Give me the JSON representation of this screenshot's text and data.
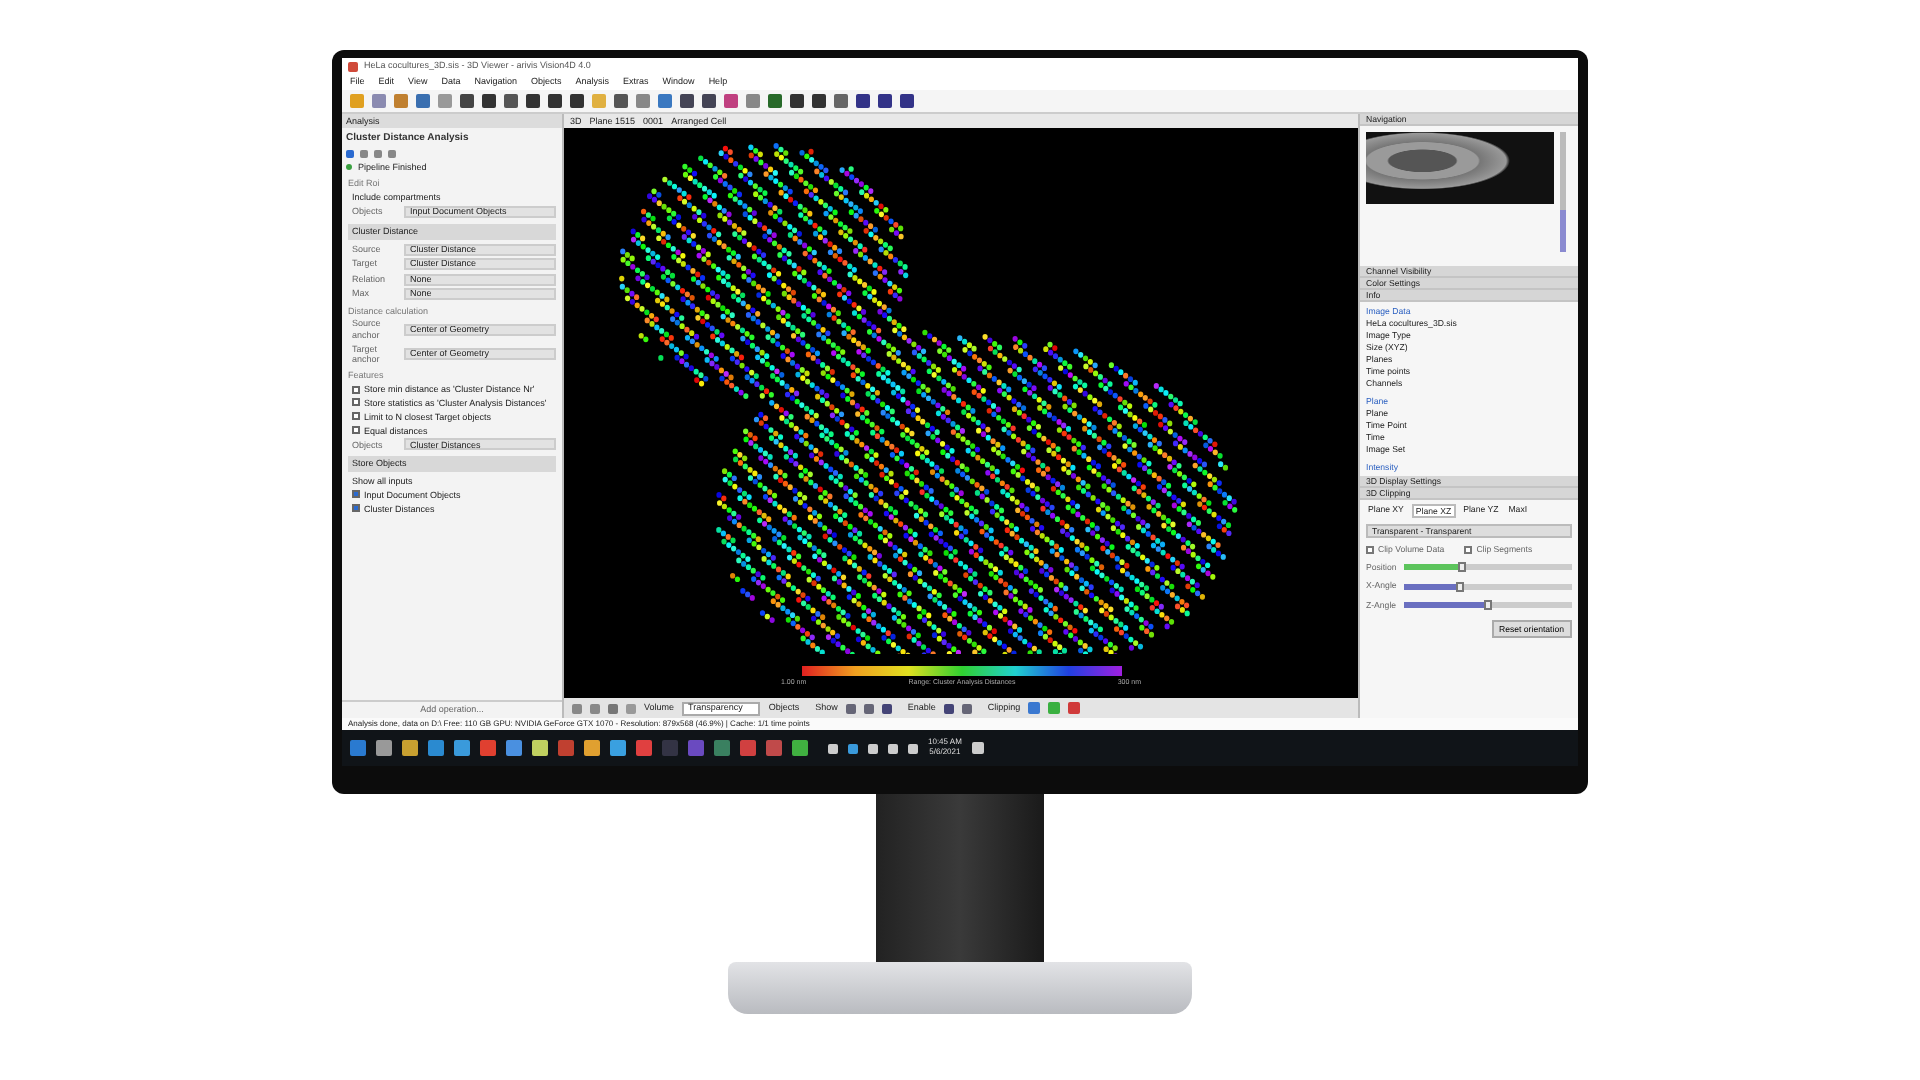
{
  "window": {
    "title": "HeLa cocultures_3D.sis - 3D Viewer - arivis Vision4D 4.0"
  },
  "menu": [
    "File",
    "Edit",
    "View",
    "Data",
    "Navigation",
    "Objects",
    "Analysis",
    "Extras",
    "Window",
    "Help"
  ],
  "analysis_panel": {
    "title": "Analysis",
    "header": "Cluster Distance Analysis",
    "status": "Pipeline Finished",
    "items": [
      {
        "kind": "heading",
        "text": "Edit Roi"
      },
      {
        "kind": "text",
        "text": "Include compartments"
      },
      {
        "kind": "field",
        "label": "Objects",
        "value": "Input Document Objects"
      },
      {
        "kind": "section",
        "text": "Cluster Distance"
      },
      {
        "kind": "field",
        "label": "Source",
        "value": "Cluster Distance"
      },
      {
        "kind": "field",
        "label": "Target",
        "value": "Cluster Distance"
      },
      {
        "kind": "field",
        "label": "Relation",
        "value": "None"
      },
      {
        "kind": "field",
        "label": "Max",
        "value": "None"
      },
      {
        "kind": "heading",
        "text": "Distance calculation"
      },
      {
        "kind": "field",
        "label": "Source anchor",
        "value": "Center of Geometry"
      },
      {
        "kind": "field",
        "label": "Target anchor",
        "value": "Center of Geometry"
      },
      {
        "kind": "heading",
        "text": "Features"
      },
      {
        "kind": "check",
        "text": "Store min distance as 'Cluster Distance Nr'",
        "checked": false
      },
      {
        "kind": "check",
        "text": "Store statistics as 'Cluster Analysis Distances'",
        "checked": false
      },
      {
        "kind": "check",
        "text": "Limit to N closest Target objects",
        "checked": false
      },
      {
        "kind": "check",
        "text": "Equal distances",
        "checked": false
      },
      {
        "kind": "field",
        "label": "Objects",
        "value": "Cluster Distances"
      },
      {
        "kind": "section",
        "text": "Store Objects"
      },
      {
        "kind": "text",
        "text": "Show all inputs"
      },
      {
        "kind": "check",
        "text": "Input Document Objects",
        "checked": true
      },
      {
        "kind": "check",
        "text": "Cluster Distances",
        "checked": true
      }
    ],
    "footer": "Add operation..."
  },
  "viewer": {
    "breadcrumb": [
      "3D",
      "Plane 1515",
      "0001",
      "Arranged Cell"
    ],
    "scale": {
      "min": "1.00 nm",
      "title": "Range: Cluster Analysis Distances",
      "max": "300 nm"
    },
    "toolbar": {
      "volume": "Volume",
      "render_mode": "Transparency",
      "objects": "Objects",
      "show": "Show",
      "enable": "Enable",
      "clipping": "Clipping"
    }
  },
  "status_bar": "Analysis done, data on D:\\ Free: 110 GB  GPU: NVIDIA GeForce GTX 1070 - Resolution: 879x568 (46.9%) | Cache: 1/1 time points",
  "right_panel": {
    "sections": [
      "Navigation",
      "Channel Visibility",
      "Color Settings",
      "Info"
    ],
    "zoom": {
      "level": 0.35
    },
    "image_data": {
      "title": "Image Data",
      "rows": [
        "HeLa cocultures_3D.sis",
        "Image Type",
        "Size (XYZ)",
        "Planes",
        "Time points",
        "Channels"
      ]
    },
    "plane": {
      "title": "Plane",
      "rows": [
        "Plane",
        "Time Point",
        "Time",
        "Image Set"
      ]
    },
    "intensity": "Intensity",
    "lower_sections": [
      "3D Display Settings",
      "3D Clipping"
    ],
    "tabs": [
      {
        "label": "Plane XY",
        "selected": false
      },
      {
        "label": "Plane XZ",
        "selected": true
      },
      {
        "label": "Plane YZ",
        "selected": false
      },
      {
        "label": "MaxI",
        "selected": false
      }
    ],
    "mode": "Transparent - Transparent",
    "options": [
      {
        "label": "Clip Volume Data",
        "checked": false
      },
      {
        "label": "Clip Segments",
        "checked": false
      }
    ],
    "sliders": [
      {
        "label": "Position",
        "level": 0.35,
        "color": "#5cc45c"
      },
      {
        "label": "X-Angle",
        "level": 0.33,
        "color": "#6a6fc0"
      },
      {
        "label": "Z-Angle",
        "level": 0.5,
        "color": "#6a6fc0"
      }
    ],
    "reset": "Reset orientation"
  },
  "taskbar": {
    "clock": {
      "time": "10:45 AM",
      "date": "5/6/2021"
    }
  }
}
